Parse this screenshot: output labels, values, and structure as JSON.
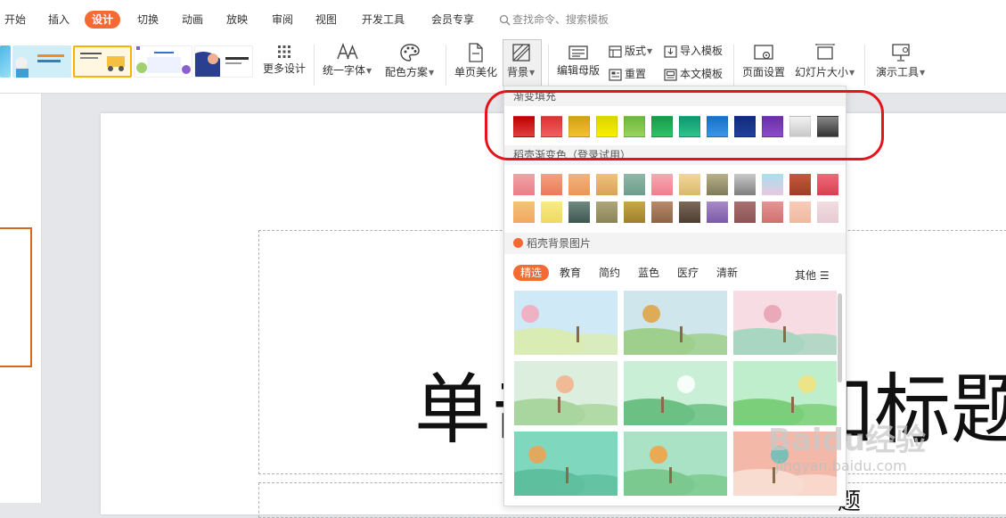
{
  "menu": {
    "items": [
      "开始",
      "插入",
      "设计",
      "切换",
      "动画",
      "放映",
      "审阅",
      "视图",
      "开发工具",
      "会员专享"
    ],
    "active_index": 2,
    "search_placeholder": "查找命令、搜索模板"
  },
  "ribbon": {
    "more_design": "更多设计",
    "unify_font": "统一字体",
    "color_scheme": "配色方案",
    "single_page_beautify": "单页美化",
    "background": "背景",
    "edit_master": "编辑母版",
    "layout": "版式",
    "reset": "重置",
    "import_template": "导入模板",
    "this_template": "本文模板",
    "page_setup": "页面设置",
    "slide_size": "幻灯片大小",
    "presentation_tools": "演示工具",
    "template_thumbs": [
      {
        "text": ""
      },
      {
        "text": "头条我们在这里"
      },
      {
        "text": "现代工作汇报"
      },
      {
        "text": ""
      },
      {
        "text": "年终工作汇报"
      }
    ]
  },
  "dropdown": {
    "gradient_fill_title": "渐变填充",
    "gradient_colors": [
      [
        "#c00000",
        "#e04040"
      ],
      [
        "#e03030",
        "#f06060"
      ],
      [
        "#d4a017",
        "#f2c230"
      ],
      [
        "#dcd400",
        "#f7f000"
      ],
      [
        "#6cb83a",
        "#9ad45c"
      ],
      [
        "#1a9a4a",
        "#2ec266"
      ],
      [
        "#10976e",
        "#2ec48c"
      ],
      [
        "#1870c4",
        "#3b95e6"
      ],
      [
        "#0f2d7a",
        "#233f9c"
      ],
      [
        "#6a2ea8",
        "#8a4cc8"
      ],
      [
        "#f2f2f2",
        "#c8c8c8"
      ],
      [
        "#888888",
        "#333333"
      ]
    ],
    "daoke_gradient_title": "稻壳渐变色（登录试用）",
    "daoke_gradient_row1": [
      [
        "#f2a3a8",
        "#e97f88"
      ],
      [
        "#f4a17e",
        "#ea7a5a"
      ],
      [
        "#f4b27c",
        "#e8975a"
      ],
      [
        "#f0c27a",
        "#d8a35c"
      ],
      [
        "#8fb8a8",
        "#6e9c8c"
      ],
      [
        "#f7a9b3",
        "#ee7f8d"
      ],
      [
        "#f2d795",
        "#d9b96f"
      ],
      [
        "#b8b28a",
        "#7f7a58"
      ],
      [
        "#c9c9c9",
        "#7e7e7e"
      ],
      [
        "#a8e0ee",
        "#e8c8e0"
      ],
      [
        "#c75a3a",
        "#9c3e28"
      ],
      [
        "#ee6a7a",
        "#d84050"
      ]
    ],
    "daoke_gradient_row2": [
      [
        "#f7c27a",
        "#f0a860"
      ],
      [
        "#f8ea88",
        "#eeda60"
      ],
      [
        "#6f8a80",
        "#3e5650"
      ],
      [
        "#aca67a",
        "#8a8458"
      ],
      [
        "#c8a848",
        "#9c802c"
      ],
      [
        "#b88a6a",
        "#8c6448"
      ],
      [
        "#7c6a58",
        "#4c3e32"
      ],
      [
        "#a88ac8",
        "#7a5aa8"
      ],
      [
        "#a87070",
        "#8c5454"
      ],
      [
        "#e89494",
        "#d07070"
      ],
      [
        "#f7ccb8",
        "#f0b8a0"
      ],
      [
        "#f0dde2",
        "#e6cad2"
      ]
    ],
    "bg_image_title": "稻壳背景图片",
    "tabs": [
      "精选",
      "教育",
      "简约",
      "蓝色",
      "医疗",
      "清新"
    ],
    "more_label": "其他",
    "bg_images": [
      {
        "sky": "#cfe9f7",
        "ground": "#d9ecb4",
        "accent": "#f4a7bb"
      },
      {
        "sky": "#cfe6ec",
        "ground": "#9fcf8c",
        "accent": "#e0a040"
      },
      {
        "sky": "#f7dce4",
        "ground": "#a9d6c0",
        "accent": "#e8a0b0"
      },
      {
        "sky": "#dceedd",
        "ground": "#a9d69e",
        "accent": "#f3b08a"
      },
      {
        "sky": "#c9efd7",
        "ground": "#6cc084",
        "accent": "#ffffff"
      },
      {
        "sky": "#bfeecd",
        "ground": "#7ccf7a",
        "accent": "#f5e27a"
      },
      {
        "sky": "#7fd8bd",
        "ground": "#5ebf9e",
        "accent": "#f2a050"
      },
      {
        "sky": "#a9e2c4",
        "ground": "#7cc98f",
        "accent": "#f4a040"
      },
      {
        "sky": "#f3b8a8",
        "ground": "#f9dcd0",
        "accent": "#66c0b8"
      }
    ]
  },
  "slide": {
    "title": "单击此处添加标题",
    "subtitle": "题"
  },
  "watermark": {
    "main": "Baidu经验",
    "sub": "jingyan.baidu.com"
  },
  "colors": {
    "accent": "#f46a32",
    "annotation_ring": "#e5141c"
  }
}
